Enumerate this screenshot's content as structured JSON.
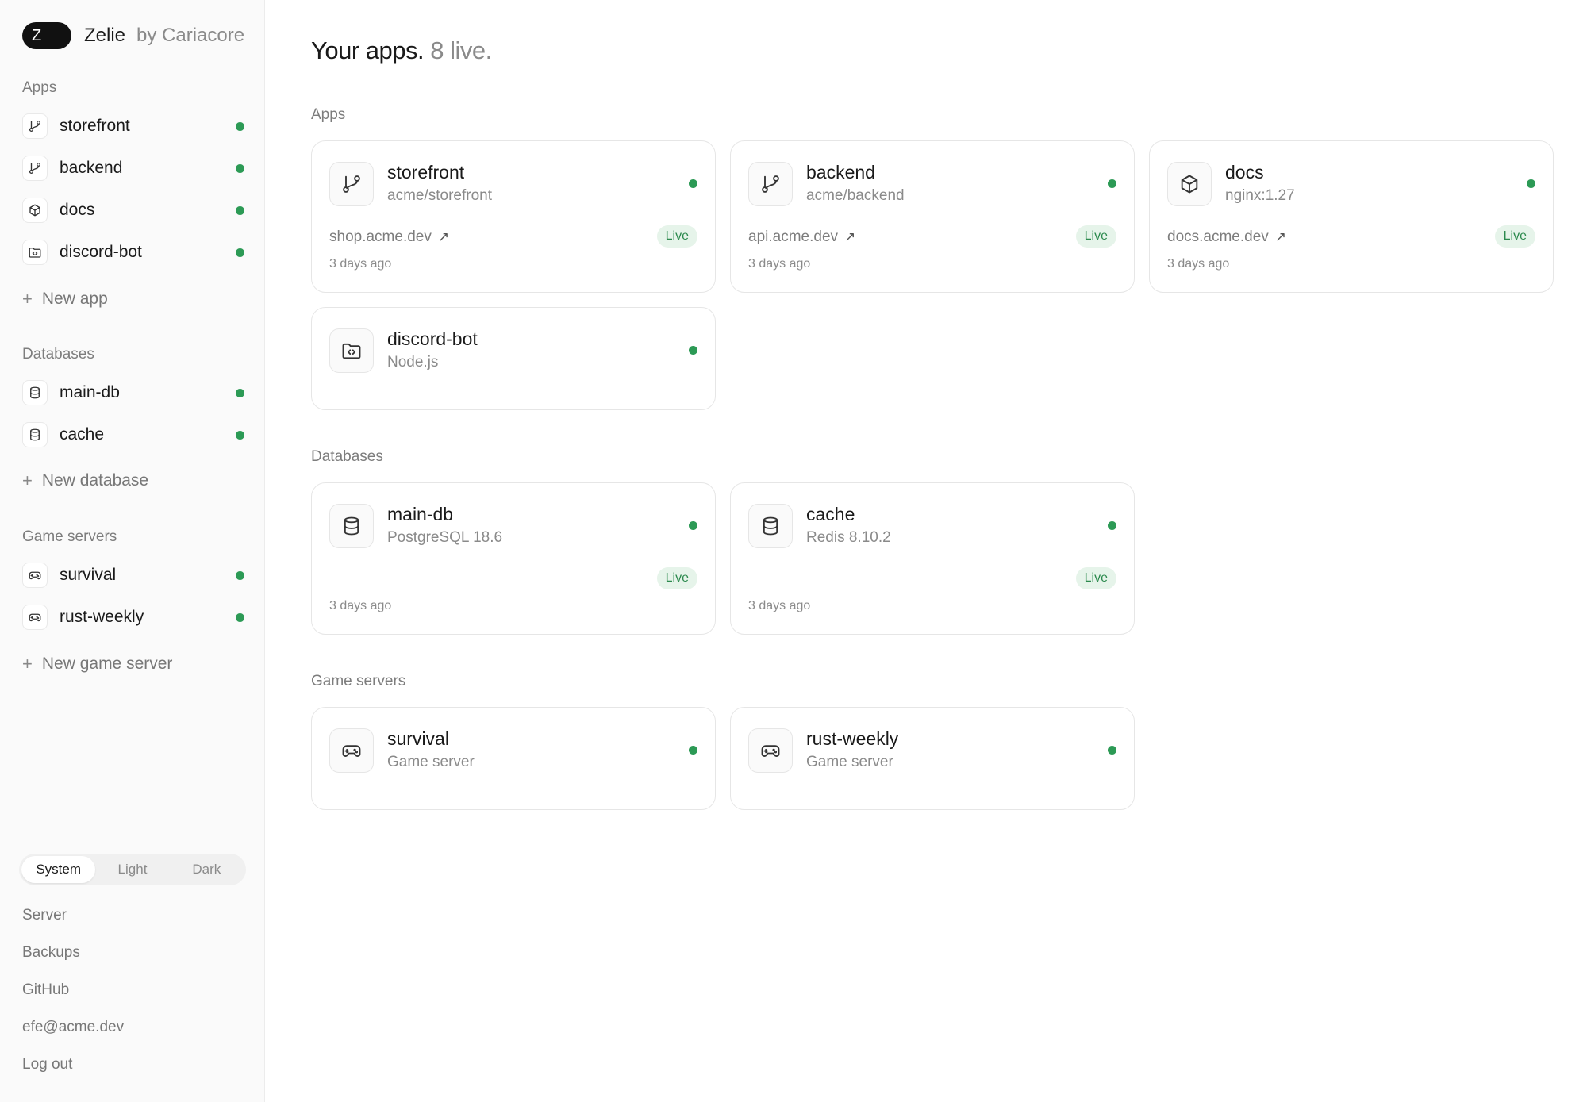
{
  "brand": {
    "initial": "Z",
    "name": "Zelie",
    "by": "by Cariacore"
  },
  "colors": {
    "live_dot": "#2c9a55",
    "badge_bg": "#e6f4ea",
    "badge_text": "#2c8a4e"
  },
  "sidebar": {
    "apps_heading": "Apps",
    "apps": [
      {
        "label": "storefront",
        "icon": "git-branch-icon"
      },
      {
        "label": "backend",
        "icon": "git-branch-icon"
      },
      {
        "label": "docs",
        "icon": "box-icon"
      },
      {
        "label": "discord-bot",
        "icon": "folder-code-icon"
      }
    ],
    "new_app": "New app",
    "databases_heading": "Databases",
    "databases": [
      {
        "label": "main-db",
        "icon": "database-icon"
      },
      {
        "label": "cache",
        "icon": "database-icon"
      }
    ],
    "new_database": "New database",
    "games_heading": "Game servers",
    "games": [
      {
        "label": "survival",
        "icon": "gamepad-icon"
      },
      {
        "label": "rust-weekly",
        "icon": "gamepad-icon"
      }
    ],
    "new_game": "New game server",
    "theme": {
      "options": [
        "System",
        "Light",
        "Dark"
      ],
      "selected": "System"
    },
    "footer": [
      "Server",
      "Backups",
      "GitHub",
      "efe@acme.dev",
      "Log out"
    ]
  },
  "main": {
    "title": "Your apps.",
    "title_sub": "8 live.",
    "apps_heading": "Apps",
    "apps": [
      {
        "name": "storefront",
        "sub": "acme/storefront",
        "url": "shop.acme.dev",
        "status": "Live",
        "time": "3 days ago"
      },
      {
        "name": "backend",
        "sub": "acme/backend",
        "url": "api.acme.dev",
        "status": "Live",
        "time": "3 days ago"
      },
      {
        "name": "docs",
        "sub": "nginx:1.27",
        "url": "docs.acme.dev",
        "status": "Live",
        "time": "3 days ago"
      },
      {
        "name": "discord-bot",
        "sub": "Node.js"
      }
    ],
    "databases_heading": "Databases",
    "databases": [
      {
        "name": "main-db",
        "sub": "PostgreSQL 18.6",
        "status": "Live",
        "time": "3 days ago"
      },
      {
        "name": "cache",
        "sub": "Redis 8.10.2",
        "status": "Live",
        "time": "3 days ago"
      }
    ],
    "games_heading": "Game servers",
    "games": [
      {
        "name": "survival",
        "sub": "Game server"
      },
      {
        "name": "rust-weekly",
        "sub": "Game server"
      }
    ]
  }
}
